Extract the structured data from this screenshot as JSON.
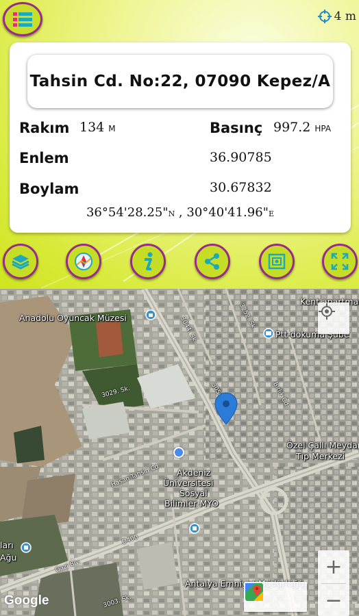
{
  "header": {
    "accuracy_text": "4 m",
    "accuracy_icon": "crosshair-icon",
    "menu_icon": "menu-list-icon"
  },
  "info": {
    "address": "Tahsin Cd. No:22, 07090 Kepez/A",
    "altitude_label": "Rakım",
    "altitude_value": "134",
    "altitude_unit": "M",
    "pressure_label": "Basınç",
    "pressure_value": "997.2",
    "pressure_unit": "HPA",
    "latitude_label": "Enlem",
    "latitude_value": "36.90785",
    "longitude_label": "Boylam",
    "longitude_value": "30.67832",
    "dms_lat": "36°54'28.25\"",
    "dms_lat_dir": "N",
    "dms_sep": ",",
    "dms_lon": "30°40'41.96\"",
    "dms_lon_dir": "E"
  },
  "toolbar": [
    {
      "name": "layers-icon"
    },
    {
      "name": "compass-map-icon"
    },
    {
      "name": "info-icon"
    },
    {
      "name": "share-icon"
    },
    {
      "name": "screenshot-icon"
    },
    {
      "name": "fullscreen-icon"
    }
  ],
  "map": {
    "labels": {
      "museum": "Anadolu Oyuncak Müzesi",
      "kent": "Kent apartmanı",
      "ptt": "Ptt-dokuma Şube",
      "ozel1": "Özel Çallı Meydan",
      "ozel2": "Tıp Merkezi",
      "akd1": "Akdeniz",
      "akd2": "Üniversitesi",
      "akd3": "Sosyal",
      "akd4": "Bilimler MYO",
      "emniyet": "Antalya Emniyet Müdürlüğü",
      "left1": "ları",
      "left2": "Ağu"
    },
    "roads": {
      "r3029": "3029. Sk.",
      "tahsin": "Hasan Tahsin Cd.",
      "d400": "D400",
      "gazi": "Gazi Blv.",
      "r3003": "3003. Sk.",
      "r3054": "3054. Sk.",
      "r3252": "3252. Sk.",
      "r2": "3044. Sk.",
      "bcd": "Bırlık Cd."
    },
    "attribution": "Google",
    "zoom_in": "+",
    "zoom_out": "−",
    "colors": {
      "pin": "#2b7bd8",
      "dot": "#4a8ae8",
      "accent_yellow": "#c5dd25",
      "accent_purple": "#9a2a8a",
      "teal": "#1fa9b8"
    }
  }
}
